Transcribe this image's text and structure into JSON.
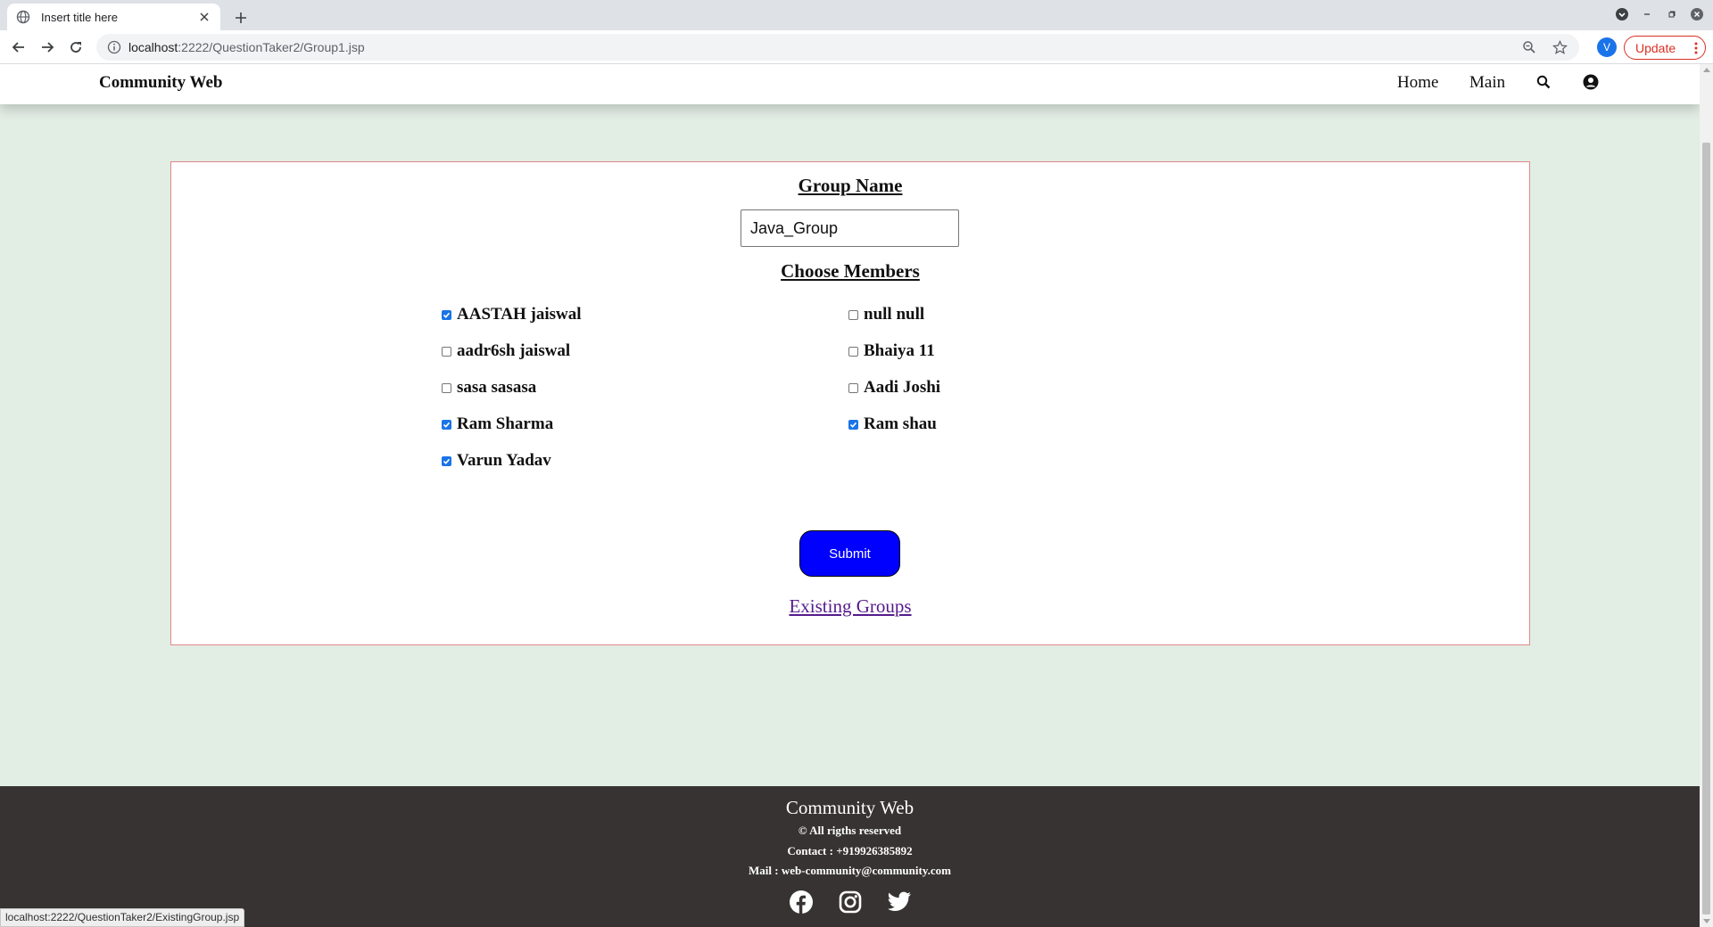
{
  "browser": {
    "tab_title": "Insert title here",
    "url_host": "localhost",
    "url_rest": ":2222/QuestionTaker2/Group1.jsp",
    "profile_initial": "V",
    "update_label": "Update",
    "status_url": "localhost:2222/QuestionTaker2/ExistingGroup.jsp"
  },
  "nav": {
    "brand": "Community Web",
    "links": [
      "Home",
      "Main"
    ]
  },
  "form": {
    "group_name_title": "Group Name",
    "group_name_value": "Java_Group",
    "members_title": "Choose Members",
    "members": [
      {
        "name": "AASTAH jaiswal",
        "checked": true
      },
      {
        "name": "null null",
        "checked": false
      },
      {
        "name": "aadr6sh jaiswal",
        "checked": false
      },
      {
        "name": "Bhaiya 11",
        "checked": false
      },
      {
        "name": "sasa sasasa",
        "checked": false
      },
      {
        "name": "Aadi Joshi",
        "checked": false
      },
      {
        "name": "Ram Sharma",
        "checked": true
      },
      {
        "name": "Ram shau",
        "checked": true
      },
      {
        "name": "Varun Yadav",
        "checked": true
      }
    ],
    "submit_label": "Submit",
    "existing_link": "Existing Groups"
  },
  "footer": {
    "title": "Community Web",
    "rights": "© All rigths reserved",
    "contact": "Contact : +919926385892",
    "mail": "Mail : web-community@community.com",
    "social_icons": [
      "facebook-icon",
      "instagram-icon",
      "twitter-icon"
    ]
  },
  "colors": {
    "page_bg": "#e2ede4",
    "submit_bg": "#0000ff",
    "footer_bg": "#383333",
    "card_border": "#e08a8a",
    "link_visited": "#551a8b"
  }
}
